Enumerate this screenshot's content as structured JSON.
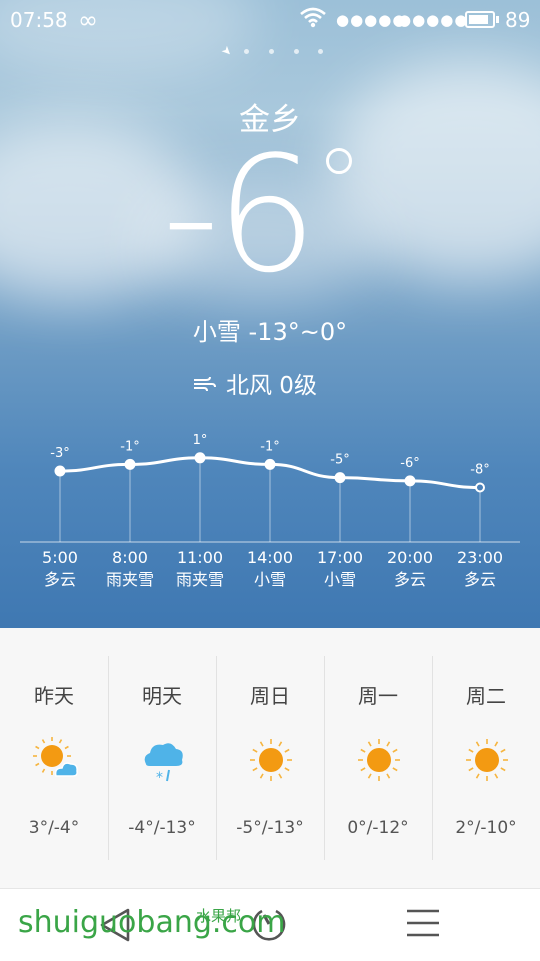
{
  "status_bar": {
    "time": "07:58",
    "signal1": "●●●●●",
    "signal2": "●●●●●",
    "battery_pct": "89"
  },
  "city": "金乡",
  "current": {
    "temp": "-6",
    "condition_line": "小雪 -13°~0°",
    "wind": "北风 0级"
  },
  "chart_data": {
    "type": "line",
    "x": [
      "5:00",
      "8:00",
      "11:00",
      "14:00",
      "17:00",
      "20:00",
      "23:00"
    ],
    "conditions": [
      "多云",
      "雨夹雪",
      "雨夹雪",
      "小雪",
      "小雪",
      "多云",
      "多云"
    ],
    "values": [
      -3,
      -1,
      1,
      -1,
      -5,
      -6,
      -8
    ],
    "point_labels": [
      "-3°",
      "-1°",
      "1°",
      "-1°",
      "-5°",
      "-6°",
      "-8°"
    ]
  },
  "forecast": [
    {
      "day": "昨天",
      "icon": "partly-cloudy-sun-icon",
      "range": "3°/-4°"
    },
    {
      "day": "明天",
      "icon": "snow-cloud-icon",
      "range": "-4°/-13°"
    },
    {
      "day": "周日",
      "icon": "sun-icon",
      "range": "-5°/-13°"
    },
    {
      "day": "周一",
      "icon": "sun-icon",
      "range": "0°/-12°"
    },
    {
      "day": "周二",
      "icon": "sun-icon",
      "range": "2°/-10°"
    }
  ],
  "watermark": {
    "text": "shuiguobang.com",
    "cn": "水果邦"
  },
  "colors": {
    "sun": "#f39a12",
    "sun_rays": "#f6b540",
    "cloud_blue": "#4fb3e8"
  }
}
